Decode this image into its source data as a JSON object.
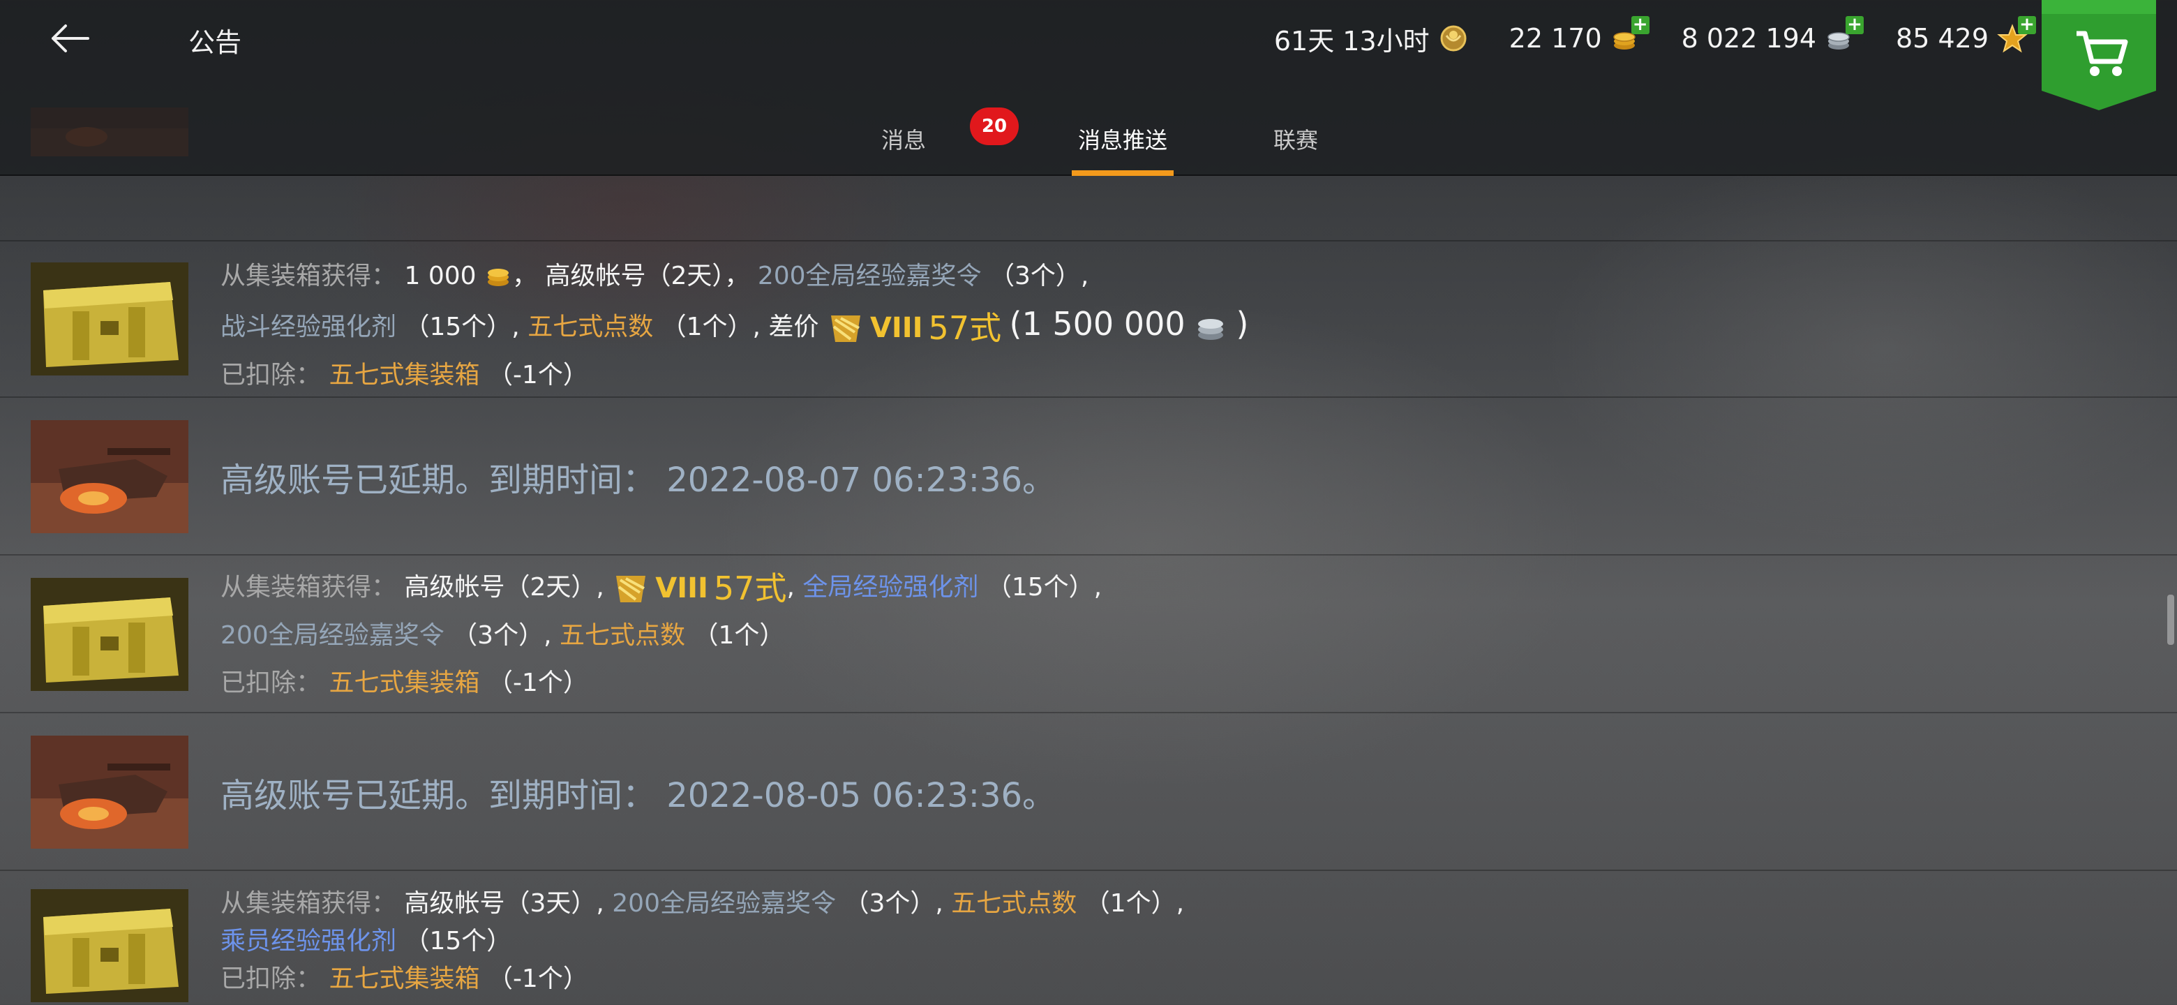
{
  "header": {
    "title": "公告",
    "currencies": {
      "premium_time": "61天 13小时",
      "gold": "22 170",
      "credits": "8 022 194",
      "free_xp": "85 429"
    },
    "tabs": [
      {
        "label": "消息",
        "badge": "20"
      },
      {
        "label": "消息推送"
      },
      {
        "label": "联赛"
      }
    ]
  },
  "messages": {
    "crate1": {
      "obtained_label": "从集装箱获得：",
      "gold_amount": "1 000",
      "sep1": "，",
      "premium": "高级帐号（2天）",
      "sep2": "，",
      "xp_order": "200全局经验嘉奖令",
      "xp_order_qty": "（3个）,",
      "booster": "战斗经验强化剂",
      "booster_qty": "（15个）,",
      "points": "五七式点数",
      "points_qty": "（1个）,",
      "diff": "差价",
      "tier": "VIII",
      "vehicle": "57式",
      "credits_open": "(1 500 000",
      "credits_close": ")",
      "deducted_label": "已扣除：",
      "deducted_item": "五七式集装箱",
      "deducted_qty": "（-1个）"
    },
    "expiry1": "高级账号已延期。到期时间： 2022-08-07 06:23:36。",
    "crate2": {
      "obtained_label": "从集装箱获得：",
      "premium": "高级帐号（2天）,",
      "tier": "VIII",
      "vehicle": "57式",
      "sep": ",",
      "booster": "全局经验强化剂",
      "booster_qty": "（15个）,",
      "xp_order": "200全局经验嘉奖令",
      "xp_order_qty": "（3个）,",
      "points": "五七式点数",
      "points_qty": "（1个）",
      "deducted_label": "已扣除：",
      "deducted_item": "五七式集装箱",
      "deducted_qty": "（-1个）"
    },
    "expiry2": "高级账号已延期。到期时间： 2022-08-05 06:23:36。",
    "crate3": {
      "obtained_label": "从集装箱获得：",
      "premium": "高级帐号（3天）,",
      "xp_order": "200全局经验嘉奖令",
      "xp_order_qty": "（3个）,",
      "points": "五七式点数",
      "points_qty": "（1个）,",
      "booster": "乘员经验强化剂",
      "booster_qty": "（15个）",
      "deducted_label": "已扣除：",
      "deducted_item": "五七式集装箱",
      "deducted_qty": "（-1个）"
    }
  },
  "colors": {
    "tab_underline": "#f39a1c",
    "badge": "#e1181c",
    "shop_green": "#2f9e2f",
    "item_orange": "#e7a642",
    "item_blue": "#6d93ea",
    "expiry_text": "#9fb1c4"
  },
  "icons": [
    "back-arrow-icon",
    "premium-badge-icon",
    "gold-coins-icon",
    "credits-icon",
    "free-xp-star-icon",
    "shopping-cart-icon",
    "tank-thumbnail",
    "crate-thumbnail"
  ]
}
